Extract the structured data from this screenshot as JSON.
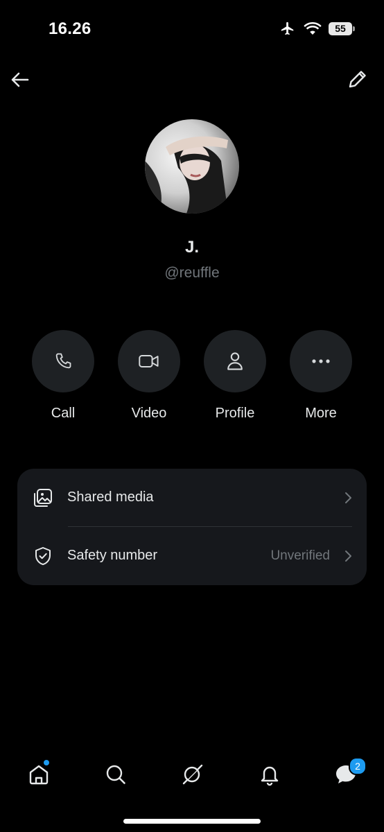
{
  "status_bar": {
    "time": "16.26",
    "battery": "55"
  },
  "profile": {
    "name": "J.",
    "handle": "@reuffle"
  },
  "actions": [
    {
      "label": "Call",
      "icon": "phone-icon"
    },
    {
      "label": "Video",
      "icon": "video-icon"
    },
    {
      "label": "Profile",
      "icon": "person-icon"
    },
    {
      "label": "More",
      "icon": "more-icon"
    }
  ],
  "settings": {
    "shared_media": {
      "label": "Shared media",
      "icon": "photos-icon"
    },
    "safety_number": {
      "label": "Safety number",
      "value": "Unverified",
      "icon": "shield-check-icon"
    }
  },
  "tabbar": {
    "items": [
      "home-icon",
      "search-icon",
      "grok-icon",
      "notifications-icon",
      "messages-icon"
    ],
    "messages_badge": "2"
  },
  "colors": {
    "accent": "#1d9bf0",
    "background": "#000000",
    "card": "#16181c",
    "muted": "#71767b"
  }
}
